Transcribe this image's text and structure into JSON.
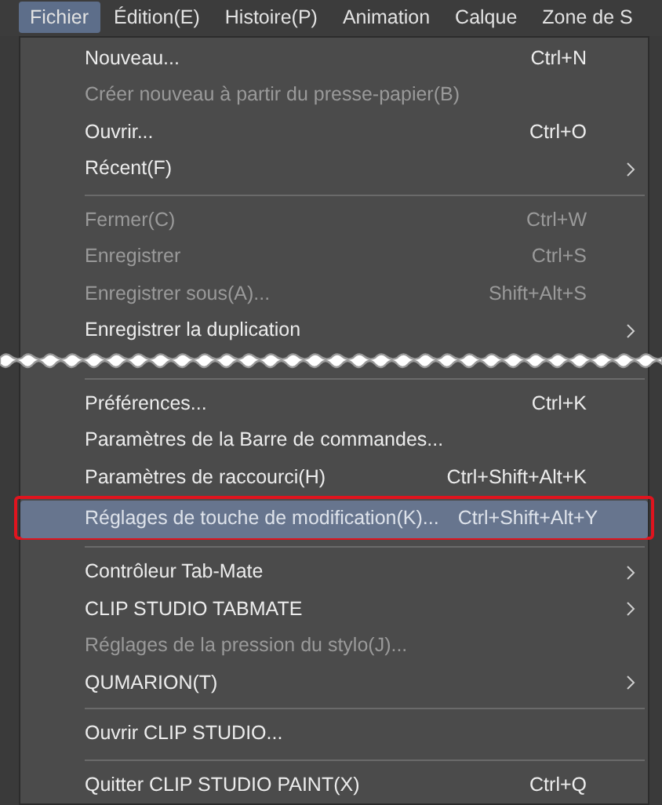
{
  "menubar": [
    {
      "label": "Fichier",
      "selected": true
    },
    {
      "label": "Édition(E)",
      "selected": false
    },
    {
      "label": "Histoire(P)",
      "selected": false
    },
    {
      "label": "Animation",
      "selected": false
    },
    {
      "label": "Calque",
      "selected": false
    },
    {
      "label": "Zone de S",
      "selected": false
    }
  ],
  "menu": [
    {
      "kind": "item",
      "label": "Nouveau...",
      "shortcut": "Ctrl+N",
      "disabled": false,
      "submenu": false,
      "selected": false
    },
    {
      "kind": "item",
      "label": "Créer nouveau à partir du presse-papier(B)",
      "disabled": true,
      "submenu": false,
      "selected": false
    },
    {
      "kind": "item",
      "label": "Ouvrir...",
      "shortcut": "Ctrl+O",
      "disabled": false,
      "submenu": false,
      "selected": false
    },
    {
      "kind": "item",
      "label": "Récent(F)",
      "disabled": false,
      "submenu": true,
      "selected": false
    },
    {
      "kind": "separator"
    },
    {
      "kind": "item",
      "label": "Fermer(C)",
      "shortcut": "Ctrl+W",
      "disabled": true,
      "submenu": false,
      "selected": false
    },
    {
      "kind": "item",
      "label": "Enregistrer",
      "shortcut": "Ctrl+S",
      "disabled": true,
      "submenu": false,
      "selected": false
    },
    {
      "kind": "item",
      "label": "Enregistrer sous(A)...",
      "shortcut": "Shift+Alt+S",
      "disabled": true,
      "submenu": false,
      "selected": false
    },
    {
      "kind": "item",
      "label": "Enregistrer la duplication",
      "disabled": false,
      "submenu": true,
      "selected": false
    },
    {
      "kind": "break"
    },
    {
      "kind": "separator"
    },
    {
      "kind": "item",
      "label": "Préférences...",
      "shortcut": "Ctrl+K",
      "disabled": false,
      "submenu": false,
      "selected": false
    },
    {
      "kind": "item",
      "label": "Paramètres de la Barre de commandes...",
      "disabled": false,
      "submenu": false,
      "selected": false
    },
    {
      "kind": "item",
      "label": "Paramètres de raccourci(H)",
      "shortcut": "Ctrl+Shift+Alt+K",
      "disabled": false,
      "submenu": false,
      "selected": false
    },
    {
      "kind": "item",
      "label": "Réglages de touche de modification(K)...",
      "shortcut": "Ctrl+Shift+Alt+Y",
      "disabled": false,
      "submenu": false,
      "selected": true,
      "outlined": true
    },
    {
      "kind": "separator"
    },
    {
      "kind": "item",
      "label": "Contrôleur Tab-Mate",
      "disabled": false,
      "submenu": true,
      "selected": false
    },
    {
      "kind": "item",
      "label": "CLIP STUDIO TABMATE",
      "disabled": false,
      "submenu": true,
      "selected": false
    },
    {
      "kind": "item",
      "label": "Réglages de la pression du stylo(J)...",
      "disabled": true,
      "submenu": false,
      "selected": false
    },
    {
      "kind": "item",
      "label": "QUMARION(T)",
      "disabled": false,
      "submenu": true,
      "selected": false
    },
    {
      "kind": "separator"
    },
    {
      "kind": "item",
      "label": "Ouvrir CLIP STUDIO...",
      "disabled": false,
      "submenu": false,
      "selected": false
    },
    {
      "kind": "separator"
    },
    {
      "kind": "item",
      "label": "Quitter CLIP STUDIO PAINT(X)",
      "shortcut": "Ctrl+Q",
      "disabled": false,
      "submenu": false,
      "selected": false
    }
  ]
}
